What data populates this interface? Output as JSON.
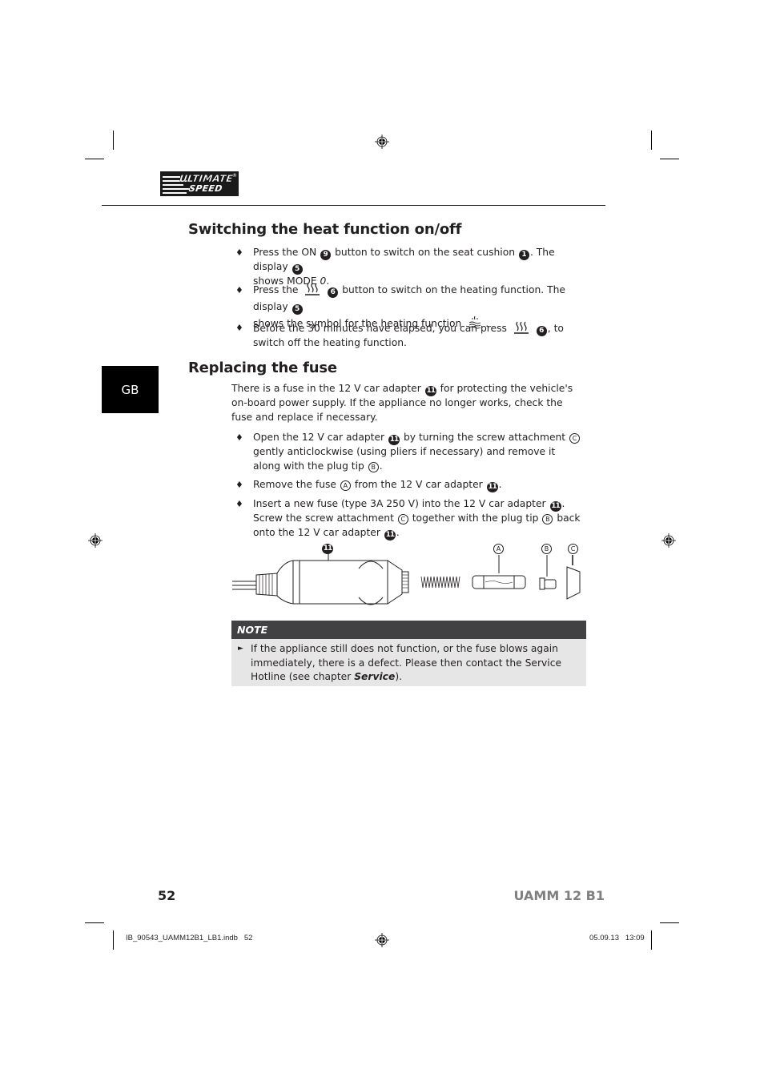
{
  "brand": {
    "logo_line1": "ULTIMATE",
    "logo_line2": "SPEED",
    "logo_reg": "®"
  },
  "language_tab": "GB",
  "section1": {
    "title": "Switching the heat function on/off",
    "bullets": [
      {
        "parts": [
          "Press the ON",
          "9",
          "button to switch on the seat cushion",
          "1",
          ". The display",
          "5",
          "shows MODE",
          "0",
          "."
        ]
      },
      {
        "parts": [
          "Press the",
          "heat-button-icon",
          "6",
          "button to switch on the heating function. The display",
          "5",
          "shows the symbol for the heating function",
          "heating-symbol-icon",
          "."
        ]
      },
      {
        "parts": [
          "Before the 30 minutes have elapsed, you can press",
          "heat-button-icon",
          "6",
          ", to switch off the heating function."
        ]
      }
    ]
  },
  "section2": {
    "title": "Replacing the fuse",
    "intro": [
      "There is a fuse in the 12 V car adapter",
      "11",
      "for protecting the vehicle's on-board power supply. If the appliance no longer works, check the fuse and replace if necessary."
    ],
    "bullets": [
      {
        "parts": [
          "Open the 12 V car adapter",
          "11",
          "by turning the screw attachment",
          "C",
          "gently anticlockwise (using pliers if necessary) and remove it along with the plug tip",
          "B",
          "."
        ]
      },
      {
        "parts": [
          "Remove the fuse",
          "A",
          "from the 12 V car adapter",
          "11",
          "."
        ]
      },
      {
        "parts": [
          "Insert a new fuse (type 3A 250 V) into the 12 V car adapter",
          "11",
          ". Screw the screw attachment",
          "C",
          "together with the plug tip",
          "B",
          "back onto the 12 V car adapter",
          "11",
          "."
        ]
      }
    ],
    "figure_labels": {
      "adapter": "11",
      "fuse": "A",
      "plug_tip": "B",
      "screw_attachment": "C"
    }
  },
  "note": {
    "heading": "NOTE",
    "text_before": "If the appliance still does not function, or the fuse blows again immediately, there is a defect. Please then contact the Service Hotline (see chapter ",
    "text_bold": "Service",
    "text_after": ")."
  },
  "footer": {
    "page_number": "52",
    "model": "UAMM 12 B1"
  },
  "slug": {
    "file": "IB_90543_UAMM12B1_LB1.indb   52",
    "datetime": "05.09.13   13:09"
  }
}
